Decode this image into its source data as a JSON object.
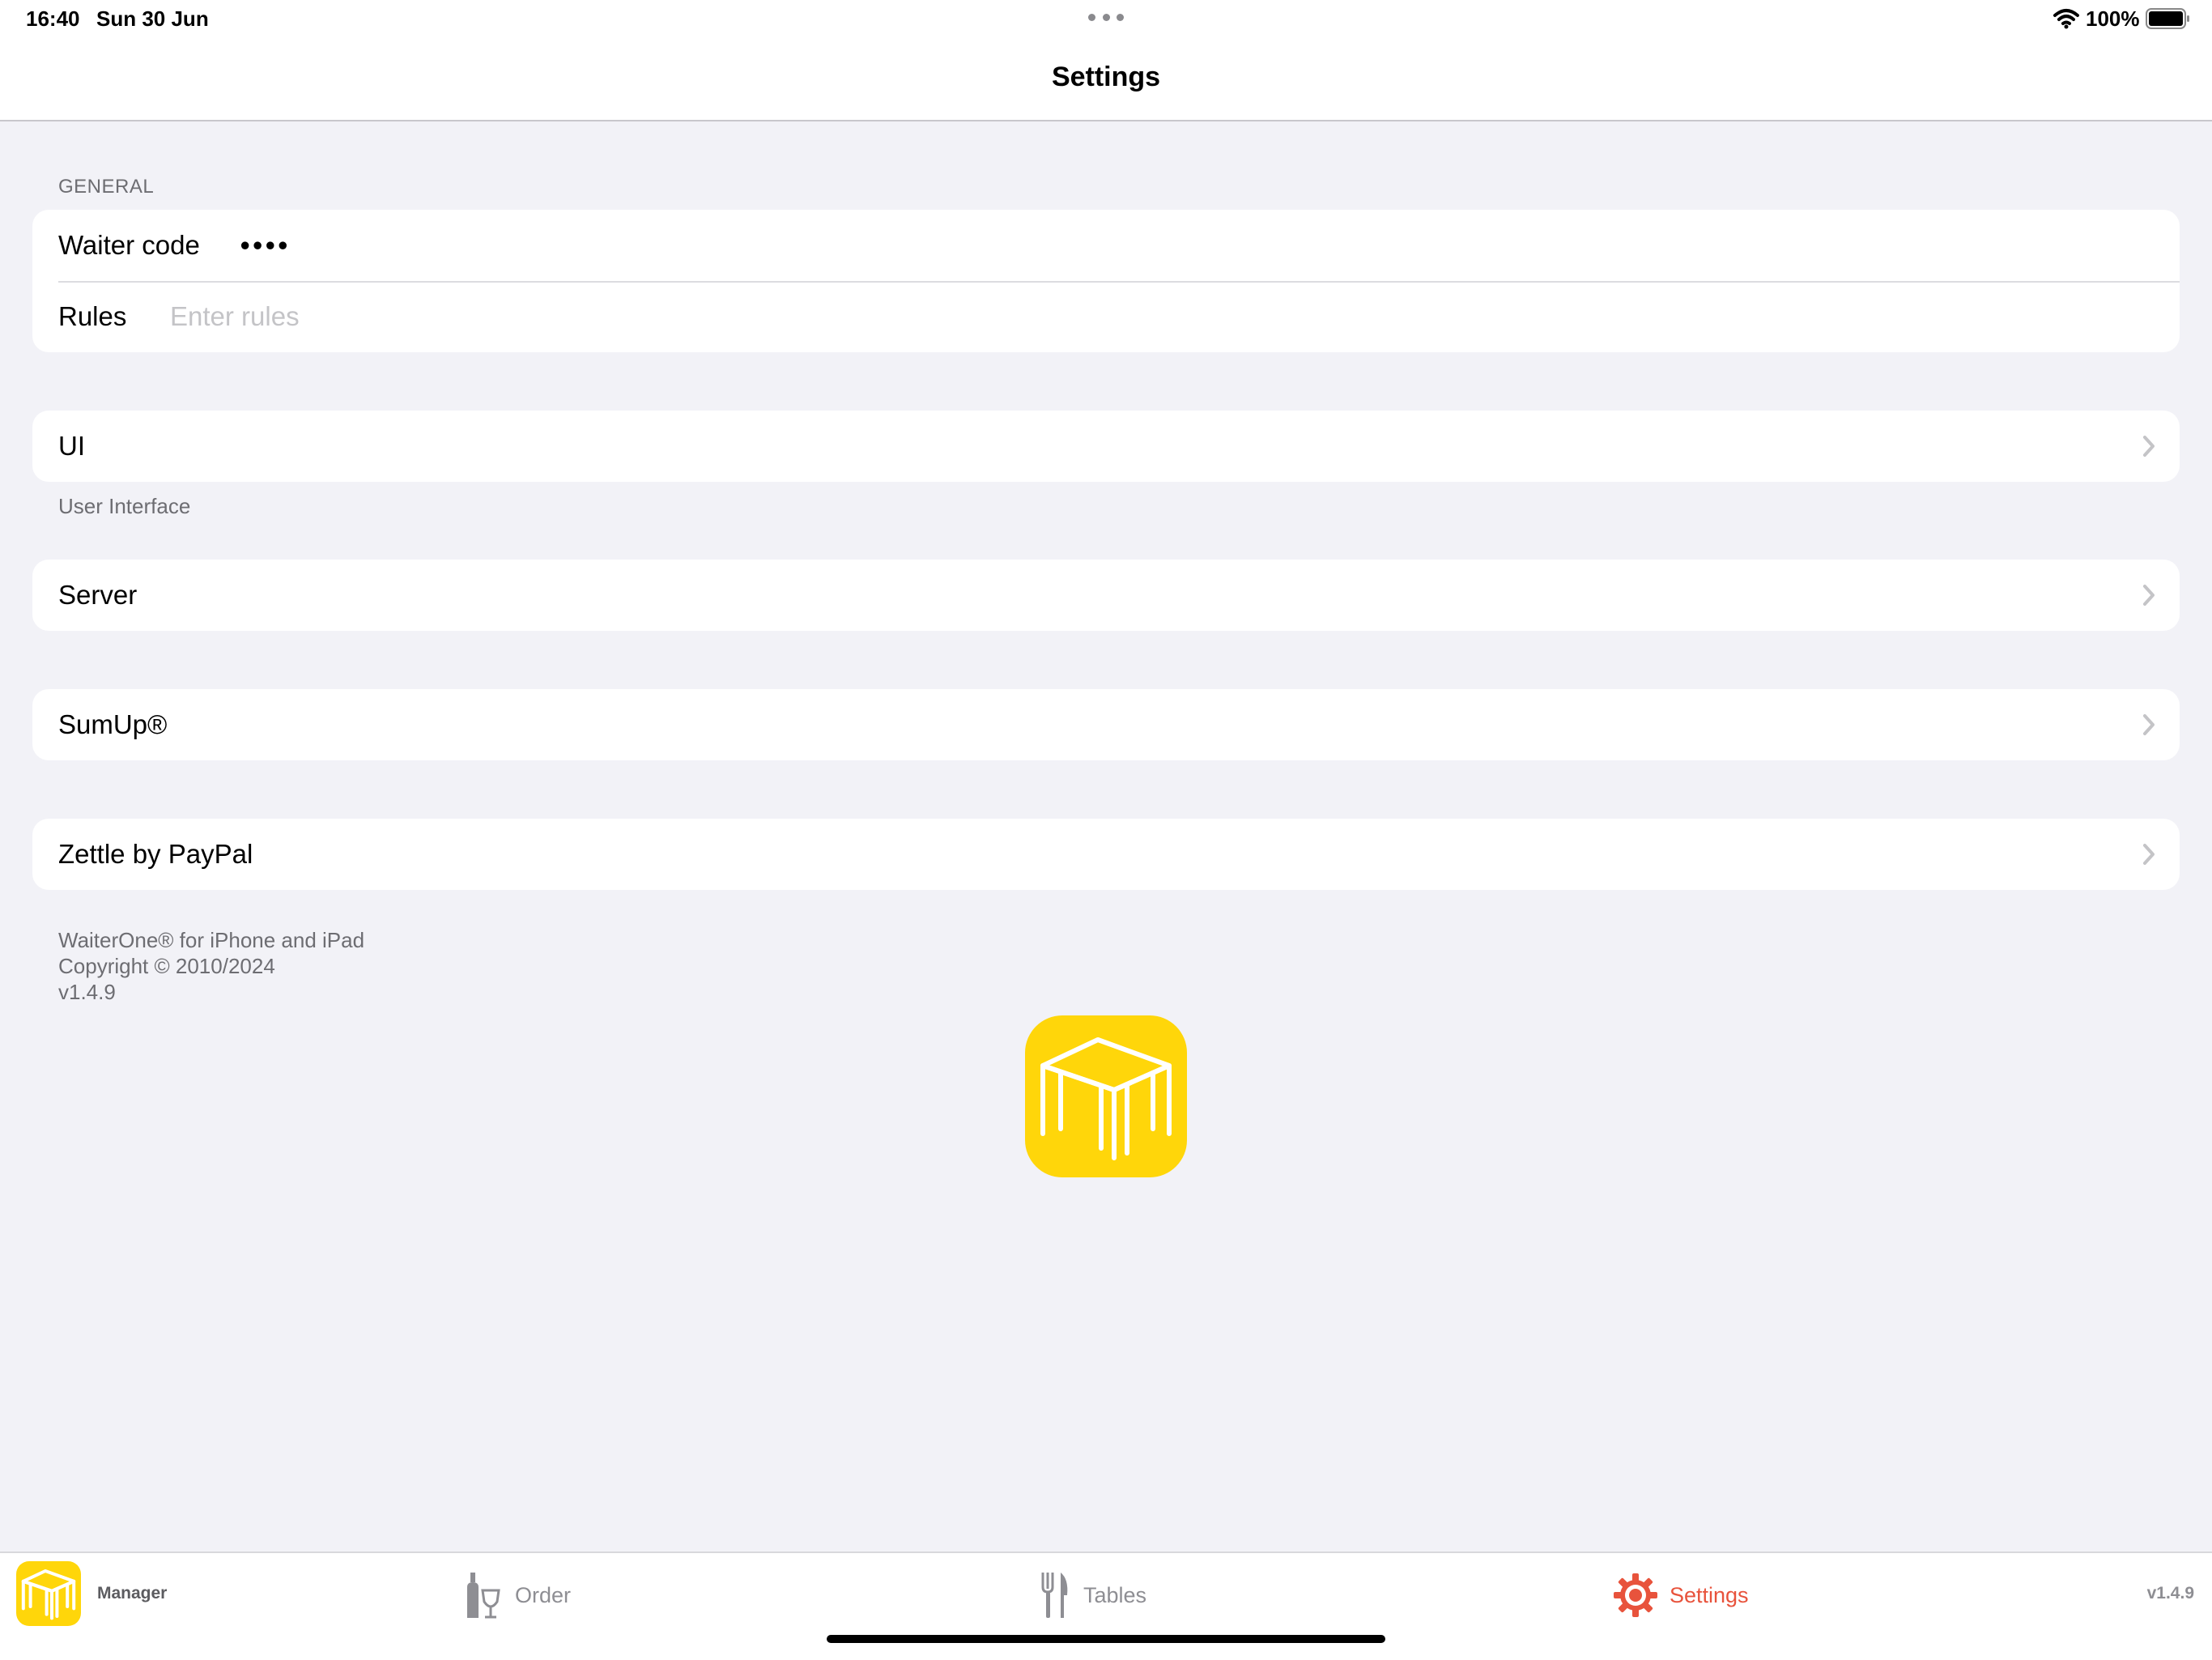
{
  "status_bar": {
    "time": "16:40",
    "date": "Sun 30 Jun",
    "battery_percent": "100%",
    "battery_level": 1.0,
    "icons": [
      "wifi-icon",
      "battery-icon",
      "multitasking-dots-icon"
    ]
  },
  "nav": {
    "title": "Settings"
  },
  "general": {
    "header": "GENERAL",
    "waiter_code_label": "Waiter code",
    "waiter_code_value": "••••",
    "rules_label": "Rules",
    "rules_placeholder": "Enter rules"
  },
  "ui_section": {
    "label": "UI",
    "footer": "User Interface"
  },
  "server_section": {
    "label": "Server"
  },
  "sumup_section": {
    "label": "SumUp®"
  },
  "zettle_section": {
    "label": "Zettle by PayPal"
  },
  "about": {
    "line1": "WaiterOne® for iPhone and iPad",
    "line2": "Copyright © 2010/2024",
    "line3": "v1.4.9"
  },
  "tabbar": {
    "manager_label": "Manager",
    "tabs": [
      {
        "label": "Order",
        "icon": "bottle-glass-icon",
        "active": false
      },
      {
        "label": "Tables",
        "icon": "fork-knife-icon",
        "active": false
      },
      {
        "label": "Settings",
        "icon": "gear-icon",
        "active": true
      }
    ],
    "version": "v1.4.9"
  },
  "colors": {
    "background": "#f2f2f7",
    "accent_active": "#e8533c",
    "brand_yellow": "#ffd60a",
    "secondary_text": "#6d6d72",
    "placeholder": "#c4c4c7"
  }
}
